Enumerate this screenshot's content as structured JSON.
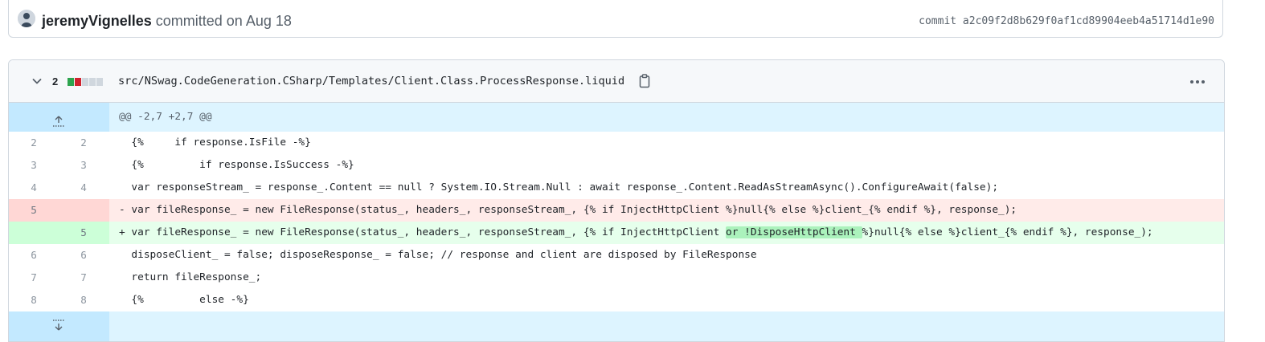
{
  "commit": {
    "author": "jeremyVignelles",
    "committed_text": "committed on Aug 18",
    "sha_text": "commit a2c09f2d8b629f0af1cd89904eeb4a51714d1e90"
  },
  "file": {
    "diffstat_count": "2",
    "diffstat_blocks": [
      "#2da44e",
      "#cf222e",
      "#d0d7de",
      "#d0d7de",
      "#d0d7de"
    ],
    "path": "src/NSwag.CodeGeneration.CSharp/Templates/Client.Class.ProcessResponse.liquid",
    "hunk_header": "@@ -2,7 +2,7 @@"
  },
  "lines": [
    {
      "type": "ctx",
      "old": "2",
      "new": "2",
      "code": "  {%     if response.IsFile -%}"
    },
    {
      "type": "ctx",
      "old": "3",
      "new": "3",
      "code": "  {%         if response.IsSuccess -%}"
    },
    {
      "type": "ctx",
      "old": "4",
      "new": "4",
      "code": "  var responseStream_ = response_.Content == null ? System.IO.Stream.Null : await response_.Content.ReadAsStreamAsync().ConfigureAwait(false);"
    },
    {
      "type": "del",
      "old": "5",
      "new": "",
      "code": "- var fileResponse_ = new FileResponse(status_, headers_, responseStream_, {% if InjectHttpClient %}null{% else %}client_{% endif %}, response_);"
    },
    {
      "type": "add",
      "old": "",
      "new": "5",
      "code_before": "+ var fileResponse_ = new FileResponse(status_, headers_, responseStream_, {% if InjectHttpClient ",
      "code_highlight": "or !DisposeHttpClient ",
      "code_after": "%}null{% else %}client_{% endif %}, response_);"
    },
    {
      "type": "ctx",
      "old": "6",
      "new": "6",
      "code": "  disposeClient_ = false; disposeResponse_ = false; // response and client are disposed by FileResponse"
    },
    {
      "type": "ctx",
      "old": "7",
      "new": "7",
      "code": "  return fileResponse_;"
    },
    {
      "type": "ctx",
      "old": "8",
      "new": "8",
      "code": "  {%         else -%}"
    }
  ]
}
